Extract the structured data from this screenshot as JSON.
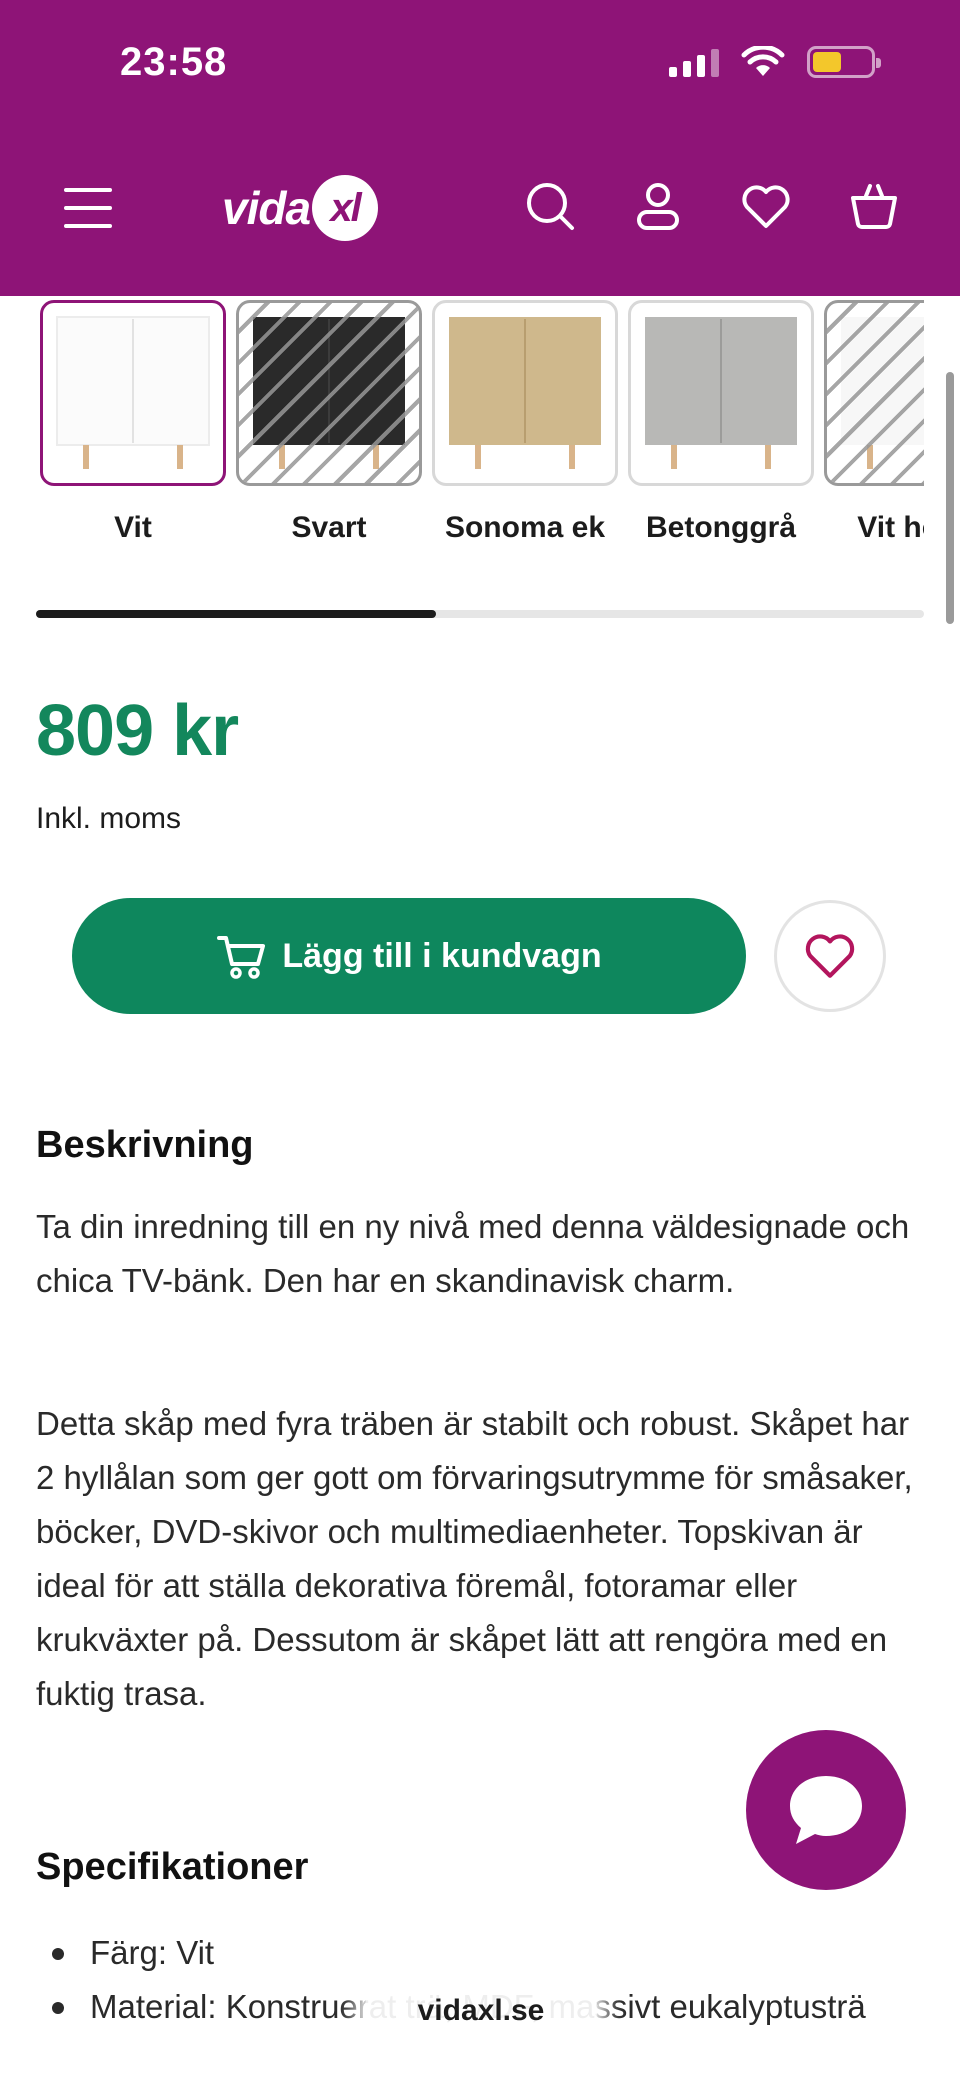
{
  "status_bar": {
    "time": "23:58"
  },
  "header": {
    "logo_prefix": "vida",
    "logo_suffix": "xl",
    "brand_color": "#8e1477"
  },
  "variants": [
    {
      "label": "Vit",
      "selected": true,
      "available": true,
      "finish": "white"
    },
    {
      "label": "Svart",
      "selected": false,
      "available": false,
      "finish": "black"
    },
    {
      "label": "Sonoma ek",
      "selected": false,
      "available": true,
      "finish": "oak"
    },
    {
      "label": "Betonggrå",
      "selected": false,
      "available": true,
      "finish": "concrete"
    },
    {
      "label": "Vit högg",
      "selected": false,
      "available": false,
      "finish": "white"
    }
  ],
  "variant_scroll_progress": 0.45,
  "price": {
    "amount": "809 kr",
    "vat_note": "Inkl. moms",
    "color": "#13875c"
  },
  "actions": {
    "add_to_cart_label": "Lägg till i kundvagn",
    "cart_button_color": "#0e875d"
  },
  "description": {
    "heading": "Beskrivning",
    "paragraphs": [
      "Ta din inredning till en ny nivå med denna väldesignade och chica TV-bänk. Den har en skandinavisk charm.",
      "Detta skåp med fyra träben är stabilt och robust. Skåpet har 2 hyllålan som ger gott om förvaringsutrymme för småsaker, böcker, DVD-skivor och multimediaenheter. Topskivan är ideal för att ställa dekorativa föremål, fotoramar eller krukväxter på. Dessutom är skåpet lätt att rengöra med en fuktig trasa."
    ]
  },
  "specifications": {
    "heading": "Specifikationer",
    "items": [
      "Färg: Vit",
      "Material: Konstruerat trä, MDF, massivt eukalyptusträ"
    ]
  },
  "browser": {
    "url": "vidaxl.se"
  },
  "icons": [
    "menu-icon",
    "search-icon",
    "account-icon",
    "heart-icon",
    "basket-icon",
    "cart-icon",
    "chat-icon"
  ]
}
